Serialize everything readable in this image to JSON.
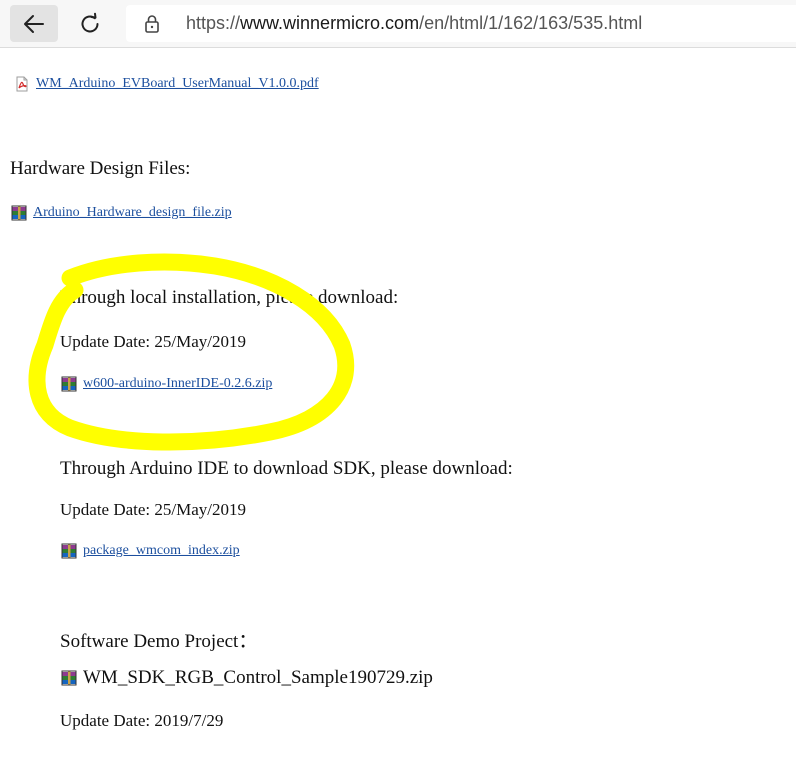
{
  "browser": {
    "url_prefix": "https://",
    "url_host": "www.winnermicro.com",
    "url_path": "/en/html/1/162/163/535.html",
    "icons": {
      "back": "arrow-left-icon",
      "refresh": "refresh-icon",
      "lock": "lock-icon"
    }
  },
  "page": {
    "manual_file": "WM_Arduino_EVBoard_UserManual_V1.0.0.pdf",
    "hardware_heading": "Hardware Design Files:",
    "hardware_file": "Arduino_Hardware_design_file.zip",
    "local_heading": "Through local installation, please download:",
    "local_date": "Update Date: 25/May/2019",
    "local_file": "w600-arduino-InnerIDE-0.2.6.zip",
    "ide_heading": "Through Arduino IDE to download SDK, please download:",
    "ide_date": "Update Date: 25/May/2019",
    "ide_file": "package_wmcom_index.zip",
    "demo_heading": "Software Demo Project：",
    "demo_file": "WM_SDK_RGB_Control_Sample190729.zip",
    "demo_date": "Update Date: 2019/7/29"
  },
  "colors": {
    "link": "#1c4f9e",
    "highlight": "#ffff00",
    "pdf_icon": "#d32f2f"
  }
}
